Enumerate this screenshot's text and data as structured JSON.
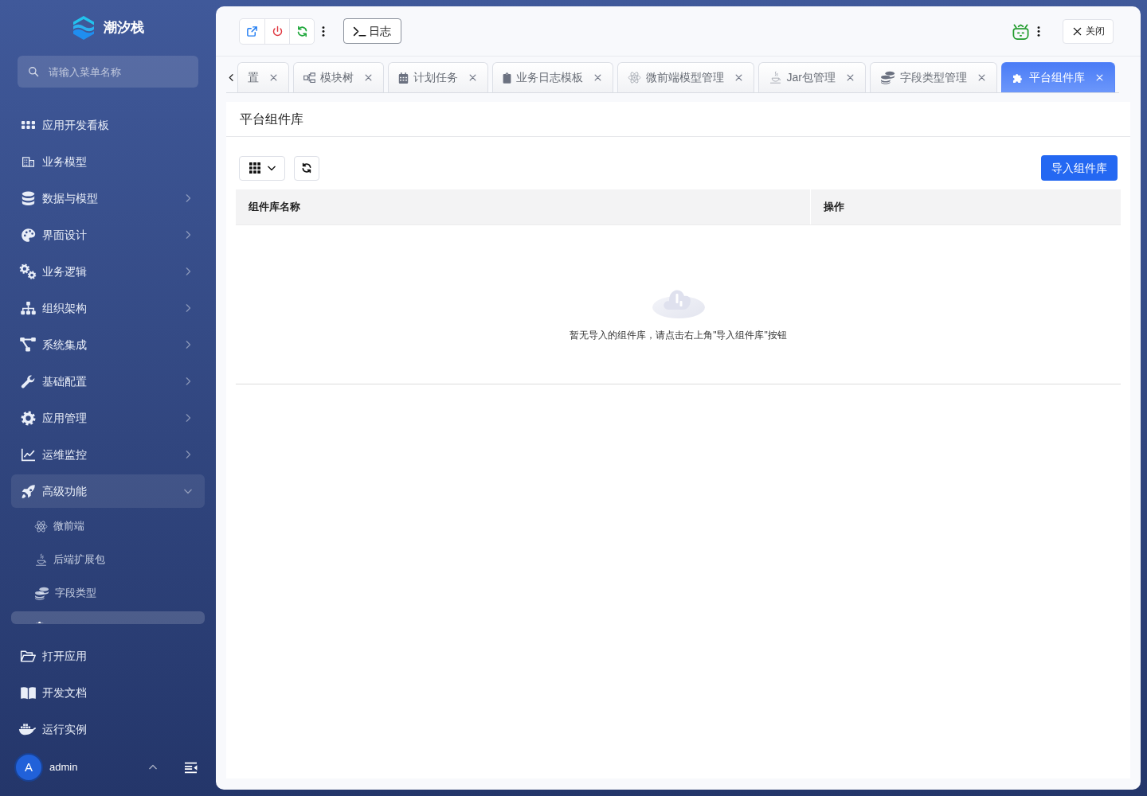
{
  "sidebar": {
    "logo_text": "潮汐栈",
    "search": {
      "placeholder": "请输入菜单名称"
    },
    "menu": [
      {
        "label": "应用开发看板",
        "kind": "link"
      },
      {
        "label": "业务模型",
        "kind": "link"
      },
      {
        "label": "数据与模型",
        "kind": "group",
        "expanded": false
      },
      {
        "label": "界面设计",
        "kind": "group",
        "expanded": false
      },
      {
        "label": "业务逻辑",
        "kind": "group",
        "expanded": false
      },
      {
        "label": "组织架构",
        "kind": "group",
        "expanded": false
      },
      {
        "label": "系统集成",
        "kind": "group",
        "expanded": false
      },
      {
        "label": "基础配置",
        "kind": "group",
        "expanded": false
      },
      {
        "label": "应用管理",
        "kind": "group",
        "expanded": false
      },
      {
        "label": "运维监控",
        "kind": "group",
        "expanded": false
      },
      {
        "label": "高级功能",
        "kind": "group",
        "expanded": true,
        "children": [
          {
            "label": "微前端",
            "selected": false
          },
          {
            "label": "后端扩展包",
            "selected": false
          },
          {
            "label": "字段类型",
            "selected": false
          },
          {
            "selected": true
          }
        ]
      }
    ],
    "bottom_menu": [
      {
        "label": "打开应用"
      },
      {
        "label": "开发文档"
      },
      {
        "label": "运行实例"
      }
    ],
    "user": {
      "avatar": "A",
      "name": "admin"
    }
  },
  "toolbar": {
    "log_button": "日志",
    "close_button": "关闭"
  },
  "tabs": [
    {
      "label": "置",
      "selected": false
    },
    {
      "label": "模块树",
      "selected": false
    },
    {
      "label": "计划任务",
      "selected": false
    },
    {
      "label": "业务日志模板",
      "selected": false
    },
    {
      "label": "微前端模型管理",
      "selected": false
    },
    {
      "label": "Jar包管理",
      "selected": false
    },
    {
      "label": "字段类型管理",
      "selected": false
    },
    {
      "label": "平台组件库",
      "selected": true
    }
  ],
  "page": {
    "title": "平台组件库",
    "import_button": "导入组件库",
    "table": {
      "columns": [
        "组件库名称",
        "操作"
      ],
      "empty_text": "暂无导入的组件库，请点击右上角\"导入组件库\"按钮"
    }
  }
}
